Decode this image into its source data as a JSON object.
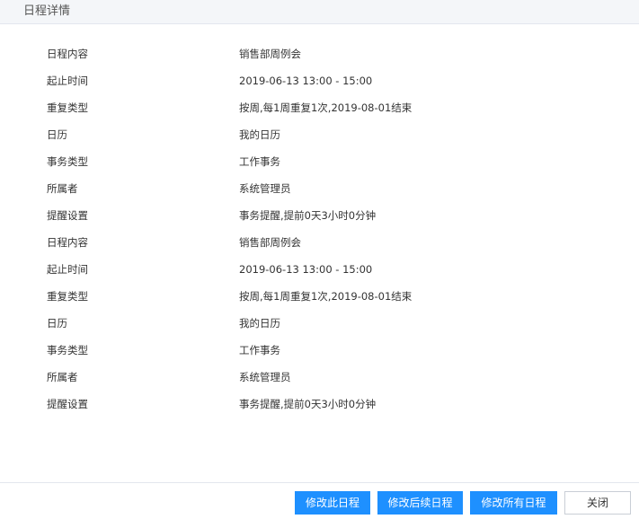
{
  "dialog": {
    "title": "日程详情"
  },
  "details": [
    {
      "label": "日程内容",
      "value": "销售部周例会"
    },
    {
      "label": "起止时间",
      "value": "2019-06-13 13:00 - 15:00"
    },
    {
      "label": "重复类型",
      "value": "按周,每1周重复1次,2019-08-01结束"
    },
    {
      "label": "日历",
      "value": "我的日历"
    },
    {
      "label": "事务类型",
      "value": "工作事务"
    },
    {
      "label": "所属者",
      "value": "系统管理员"
    },
    {
      "label": "提醒设置",
      "value": "事务提醒,提前0天3小时0分钟"
    },
    {
      "label": "日程内容",
      "value": "销售部周例会"
    },
    {
      "label": "起止时间",
      "value": "2019-06-13 13:00 - 15:00"
    },
    {
      "label": "重复类型",
      "value": "按周,每1周重复1次,2019-08-01结束"
    },
    {
      "label": "日历",
      "value": "我的日历"
    },
    {
      "label": "事务类型",
      "value": "工作事务"
    },
    {
      "label": "所属者",
      "value": "系统管理员"
    },
    {
      "label": "提醒设置",
      "value": "事务提醒,提前0天3小时0分钟"
    }
  ],
  "footer": {
    "edit_this_label": "修改此日程",
    "edit_following_label": "修改后续日程",
    "edit_all_label": "修改所有日程",
    "close_label": "关闭"
  },
  "colors": {
    "primary": "#1e90ff",
    "header_bg": "#f4f6f9",
    "text": "#333333"
  }
}
